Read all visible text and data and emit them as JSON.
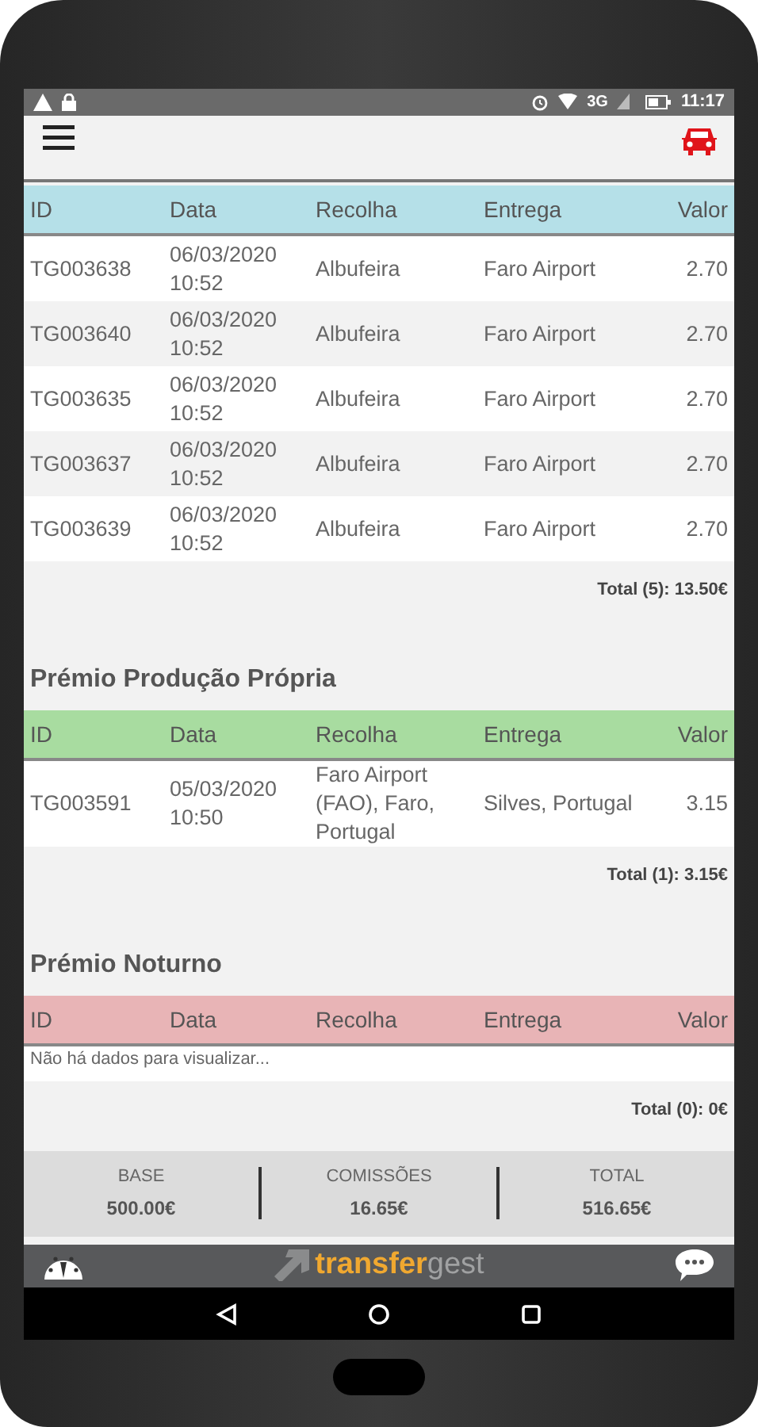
{
  "status_bar": {
    "network": "3G",
    "time": "11:17"
  },
  "tables": [
    {
      "color": "#b5e0e8",
      "columns": [
        "ID",
        "Data",
        "Recolha",
        "Entrega",
        "Valor"
      ],
      "rows": [
        [
          "TG003638",
          "06/03/2020 10:52",
          "Albufeira",
          "Faro Airport",
          "2.70"
        ],
        [
          "TG003640",
          "06/03/2020 10:52",
          "Albufeira",
          "Faro Airport",
          "2.70"
        ],
        [
          "TG003635",
          "06/03/2020 10:52",
          "Albufeira",
          "Faro Airport",
          "2.70"
        ],
        [
          "TG003637",
          "06/03/2020 10:52",
          "Albufeira",
          "Faro Airport",
          "2.70"
        ],
        [
          "TG003639",
          "06/03/2020 10:52",
          "Albufeira",
          "Faro Airport",
          "2.70"
        ]
      ],
      "total": "Total (5): 13.50€"
    },
    {
      "title": "Prémio Produção Própria",
      "color": "#a8dca0",
      "columns": [
        "ID",
        "Data",
        "Recolha",
        "Entrega",
        "Valor"
      ],
      "rows": [
        [
          "TG003591",
          "05/03/2020 10:50",
          "Faro Airport (FAO), Faro, Portugal",
          "Silves, Portugal",
          "3.15"
        ]
      ],
      "total": "Total (1): 3.15€"
    },
    {
      "title": "Prémio Noturno",
      "color": "#e8b4b6",
      "columns": [
        "ID",
        "Data",
        "Recolha",
        "Entrega",
        "Valor"
      ],
      "empty_message": "Não há dados para visualizar...",
      "total": "Total (0): 0€"
    }
  ],
  "summary": [
    {
      "label": "BASE",
      "value": "500.00€"
    },
    {
      "label": "COMISSÕES",
      "value": "16.65€"
    },
    {
      "label": "TOTAL",
      "value": "516.65€"
    }
  ],
  "logo": {
    "primary": "transfer",
    "secondary": "gest"
  }
}
